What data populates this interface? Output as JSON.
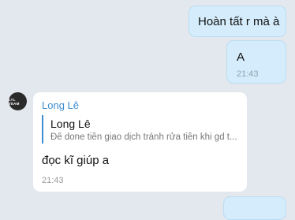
{
  "messages": {
    "out1": {
      "text": "Hoàn tất r mà à"
    },
    "out2": {
      "text": "A",
      "time": "21:43"
    },
    "in1": {
      "avatar_text": "LYL TEAM",
      "sender": "Long Lê",
      "quote": {
        "name": "Long Lê",
        "text": "Để done tiền giao dịch tránh rửa tiền khi gd t..."
      },
      "text": "đọc kĩ giúp a",
      "time": "21:43"
    }
  },
  "colors": {
    "background": "#e3e8ee",
    "outgoing_bubble": "#d4ecfb",
    "incoming_bubble": "#ffffff",
    "accent": "#3e8ed0"
  }
}
